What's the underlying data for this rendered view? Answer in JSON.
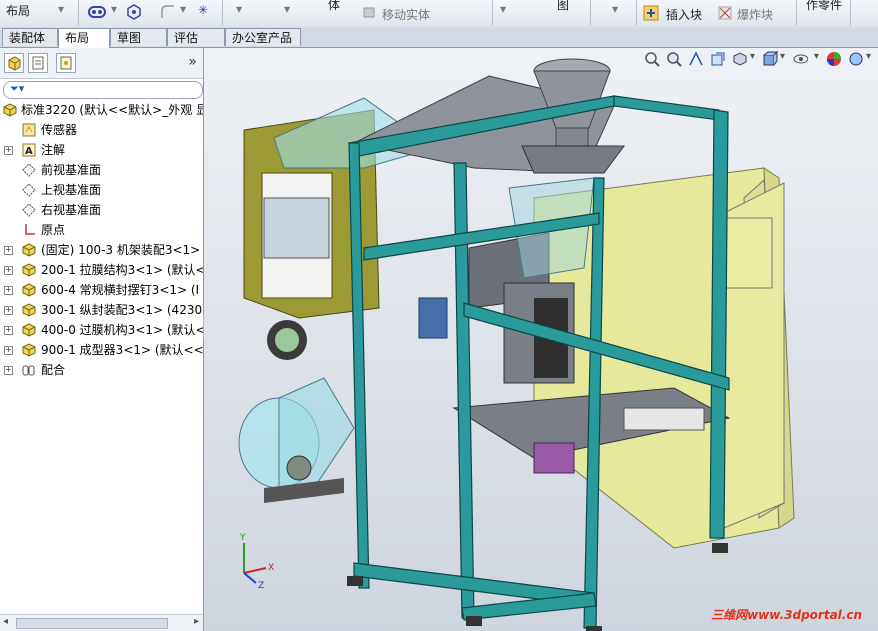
{
  "ribbon": {
    "left_label": "布局",
    "col1": "体",
    "move_body": "移动实体",
    "drawing": "图",
    "insert_block": "插入块",
    "explode_block": "爆炸块",
    "parts": "作零件"
  },
  "tabs": [
    "装配体",
    "布局",
    "草图",
    "评估",
    "办公室产品"
  ],
  "active_tab": 1,
  "tree": {
    "root": "标准3220  (默认<<默认>_外观 显",
    "items": [
      {
        "label": "传感器",
        "icon": "sensor-icon",
        "expand": false
      },
      {
        "label": "注解",
        "icon": "annotation-icon",
        "expand": true
      },
      {
        "label": "前视基准面",
        "icon": "plane-icon",
        "expand": false
      },
      {
        "label": "上视基准面",
        "icon": "plane-icon",
        "expand": false
      },
      {
        "label": "右视基准面",
        "icon": "plane-icon",
        "expand": false
      },
      {
        "label": "原点",
        "icon": "origin-icon",
        "expand": false
      },
      {
        "label": "(固定) 100-3  机架装配3<1>",
        "icon": "assembly-icon",
        "expand": true
      },
      {
        "label": "200-1  拉膜结构3<1> (默认<",
        "icon": "assembly-icon",
        "expand": true
      },
      {
        "label": "600-4  常规横封摆钉3<1> (I",
        "icon": "assembly-icon",
        "expand": true
      },
      {
        "label": "300-1  纵封装配3<1> (4230",
        "icon": "assembly-icon",
        "expand": true
      },
      {
        "label": "400-0  过膜机构3<1> (默认<",
        "icon": "assembly-icon",
        "expand": true
      },
      {
        "label": "900-1  成型器3<1> (默认<<",
        "icon": "assembly-icon",
        "expand": true
      },
      {
        "label": "配合",
        "icon": "mates-icon",
        "expand": true
      }
    ]
  },
  "watermark": "三维网www.3dportal.cn",
  "colors": {
    "frame": "#2a9a9a",
    "panel_yellow": "#e8ea9c",
    "olive": "#9a9a2a",
    "gray_plate": "#8c8f96"
  }
}
